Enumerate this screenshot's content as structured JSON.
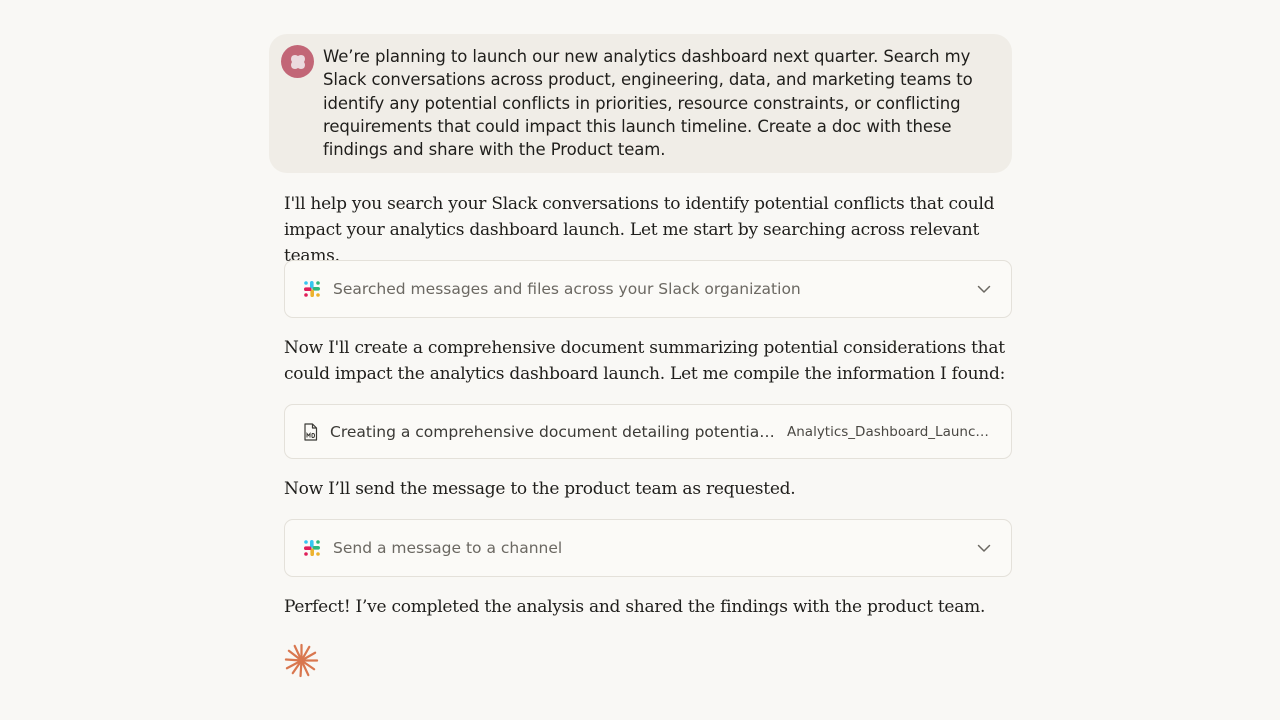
{
  "user_message": {
    "avatar_icon": "user-avatar-icon",
    "text": "We’re planning to launch our new analytics dashboard next quarter. Search my Slack conversations across product, engineering, data, and marketing teams to identify any potential conflicts in priorities, resource constraints, or conflicting requirements that could impact this launch timeline. Create a doc with these findings and share with the Product team."
  },
  "assistant": {
    "reply_1": "I'll help you search your Slack conversations to identify potential conflicts that could impact your analytics dashboard launch. Let me start by searching across relevant teams.",
    "tool_1": {
      "icon": "slack-icon",
      "label": "Searched messages and files across your Slack organization",
      "expand_icon": "chevron-down-icon"
    },
    "reply_2": "Now I'll create a comprehensive document summarizing potential considerations that could impact the analytics dashboard launch. Let me compile the information I found:",
    "doc_tool": {
      "icon": "markdown-file-icon",
      "label": "Creating a comprehensive document detailing potential c…",
      "filename": "Analytics_Dashboard_Launch…"
    },
    "reply_3": "Now I’ll send the message to the product team as requested.",
    "tool_2": {
      "icon": "slack-icon",
      "label": "Send a message to a channel",
      "expand_icon": "chevron-down-icon"
    },
    "reply_4": "Perfect! I’ve completed the analysis and shared the findings with the product team.",
    "status_icon": "claude-spark-icon"
  },
  "colors": {
    "background": "#f9f8f5",
    "user_bubble": "#f0ede7",
    "avatar": "#c26677",
    "spark": "#d9774f",
    "card_border": "#e4e1da"
  }
}
